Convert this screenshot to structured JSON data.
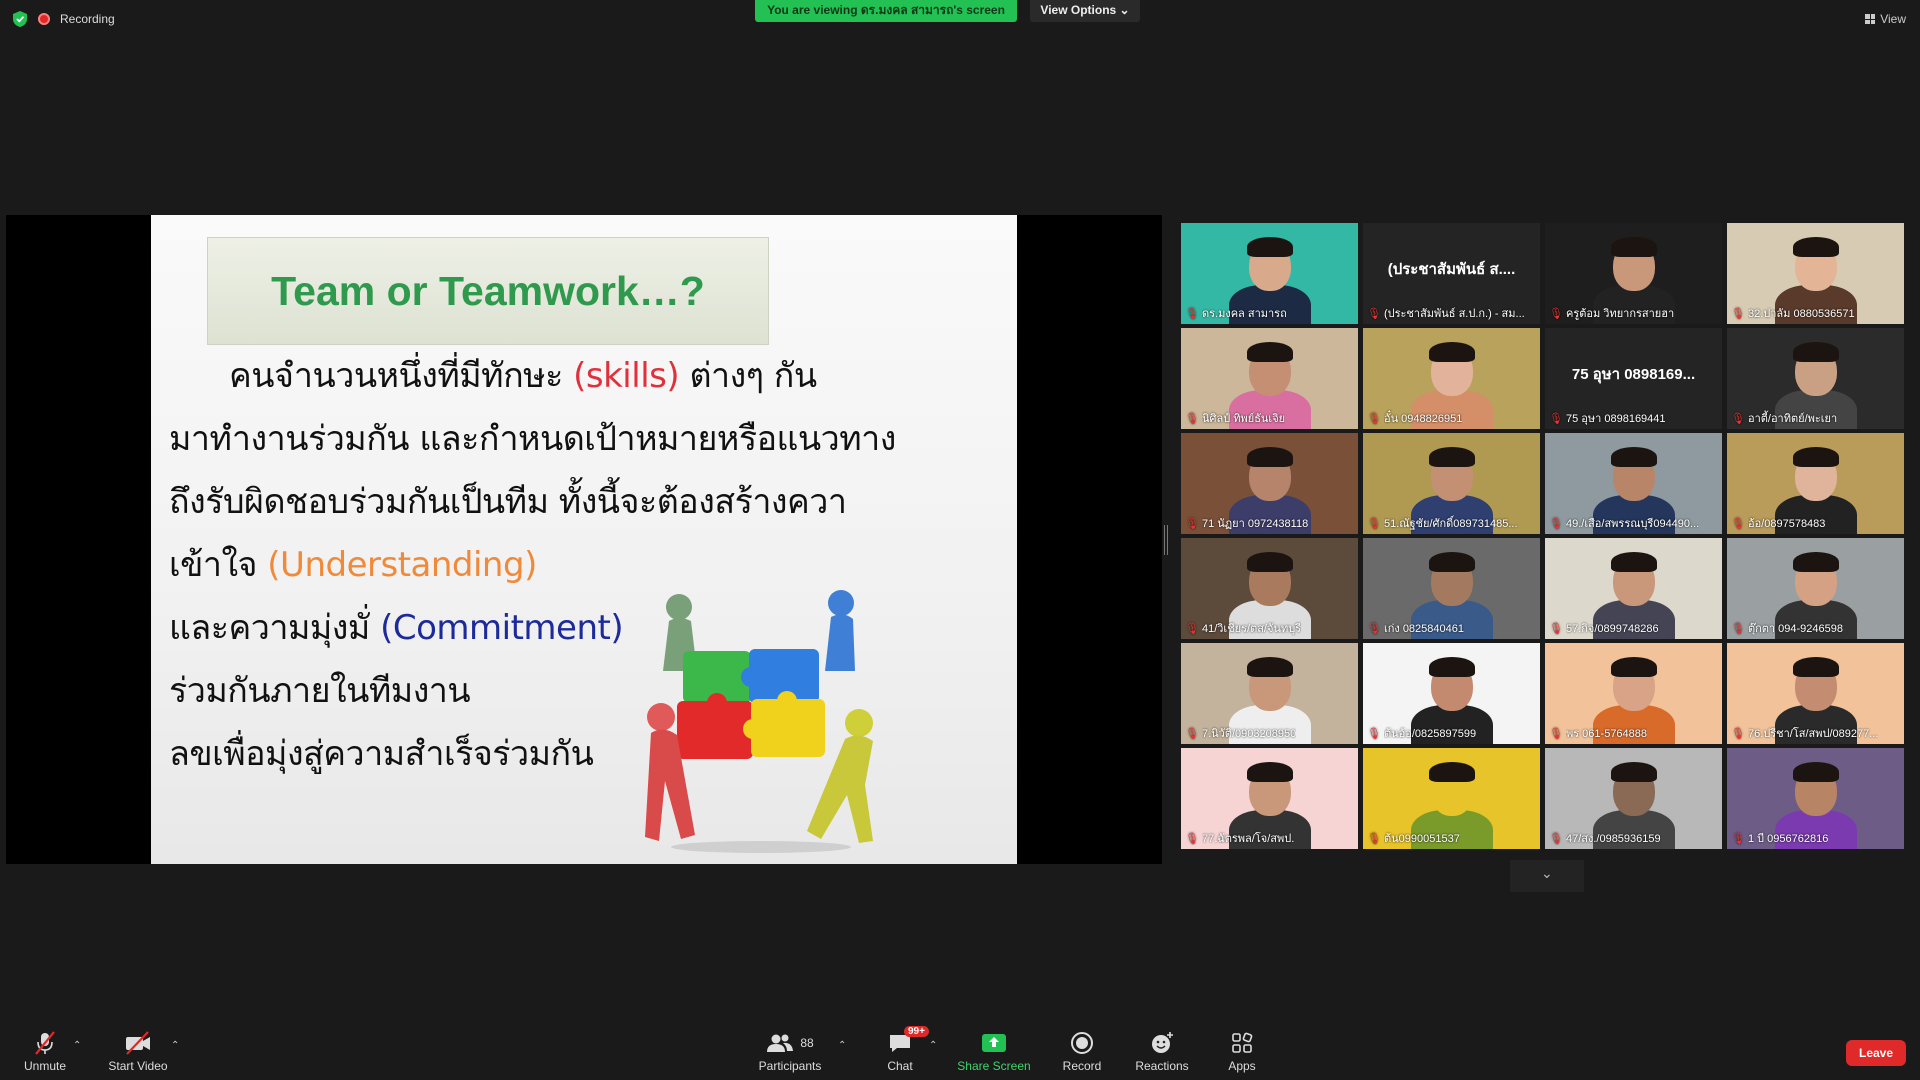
{
  "topbar": {
    "recording_label": "Recording",
    "viewing_banner": "You are viewing ดร.มงคล สามารถ's screen",
    "view_options": "View Options ⌄",
    "view_button": "View"
  },
  "slide": {
    "title": "Team or Teamwork…?",
    "lines": [
      {
        "pre": "คนจำนวนหนึ่งที่มีทักษะ ",
        "hl": "(skills)",
        "post": " ต่างๆ กัน"
      },
      {
        "pre": "มาทำงานร่วมกัน และกำหนดเป้าหมายหรือแนวทาง",
        "hl": "",
        "post": ""
      },
      {
        "pre": "ถึงรับผิดชอบร่วมกันเป็นทีม   ทั้งนี้จะต้องสร้างควา",
        "hl": "",
        "post": ""
      },
      {
        "pre": "เข้าใจ ",
        "hl": "(Understanding)",
        "post": ""
      },
      {
        "pre": "และความมุ่งมั่ ",
        "hl": "(Commitment)",
        "post": ""
      },
      {
        "pre": "ร่วมกันภายในทีมงาน",
        "hl": "",
        "post": ""
      },
      {
        "pre": "ลขเพื่อมุ่งสู่ความสำเร็จร่วมกัน",
        "hl": "",
        "post": ""
      }
    ]
  },
  "participants": [
    {
      "name": "ดร.มงคล สามารถ",
      "kind": "video",
      "bg": "#34b8a6",
      "skin": "#d8a98a",
      "shirt": "#1d2a44",
      "active": true
    },
    {
      "name": "(ประชาสัมพันธ์ ส.ป.ก.) - สม...",
      "kind": "text",
      "big": "(ประชาสัมพันธ์ ส...."
    },
    {
      "name": "ครูต้อม วิทยากรสายฮา",
      "kind": "video",
      "bg": "#1e1e1e",
      "skin": "#c9987a",
      "shirt": "#222"
    },
    {
      "name": "32.ปาลัม 0880536571",
      "kind": "video",
      "bg": "#d7cbb3",
      "skin": "#e3b596",
      "shirt": "#5a3a2a"
    },
    {
      "name": "นิศิลป์ ทิพย์ธันเจิย",
      "kind": "video",
      "bg": "#cdb79a",
      "skin": "#c48f72",
      "shirt": "#d86fa0"
    },
    {
      "name": "อั๋น 0948826951",
      "kind": "video",
      "bg": "#b9a25b",
      "skin": "#e2b39a",
      "shirt": "#d58f68"
    },
    {
      "name": "75 อุษา 0898169441",
      "kind": "text",
      "big": "75 อุษา 0898169..."
    },
    {
      "name": "อาตี้/อาทิตย์/พะเยา",
      "kind": "video",
      "bg": "#2b2b2b",
      "skin": "#c9a084",
      "shirt": "#444"
    },
    {
      "name": "71 นัฏยา 0972438118",
      "kind": "video",
      "bg": "#7a5039",
      "skin": "#b6846b",
      "shirt": "#3d3d6a"
    },
    {
      "name": "51.ณัฐชัย/ศักดิ์089731485...",
      "kind": "video",
      "bg": "#b09a52",
      "skin": "#c39074",
      "shirt": "#2f4070"
    },
    {
      "name": "49./เสือ/สพรรณบุรี094490...",
      "kind": "video",
      "bg": "#8e9aa0",
      "skin": "#b88568",
      "shirt": "#24365c"
    },
    {
      "name": "อ้อ/0897578483",
      "kind": "video",
      "bg": "#b99b5a",
      "skin": "#e0b49a",
      "shirt": "#222"
    },
    {
      "name": "41/วิเชียร/ตส/จันทบุรี",
      "kind": "video",
      "bg": "#5c4a3b",
      "skin": "#a97a5e",
      "shirt": "#ddd"
    },
    {
      "name": "เก่ง 0825840461",
      "kind": "video",
      "bg": "#6a6a6a",
      "skin": "#a37a60",
      "shirt": "#3a5a8a"
    },
    {
      "name": "57.กิจ/0899748286",
      "kind": "video",
      "bg": "#ddd8cc",
      "skin": "#c9977a",
      "shirt": "#445"
    },
    {
      "name": "ตุ๊กตา 094-9246598",
      "kind": "video",
      "bg": "#9aa0a2",
      "skin": "#d5a184",
      "shirt": "#333"
    },
    {
      "name": "7.นิวัติ/0903208950",
      "kind": "video",
      "bg": "#c3b39c",
      "skin": "#c9977a",
      "shirt": "#eee"
    },
    {
      "name": "ต้นอ้อ/0825897599",
      "kind": "video",
      "bg": "#f4f4f4",
      "skin": "#c48a70",
      "shirt": "#222"
    },
    {
      "name": "พร 061-5764888",
      "kind": "video",
      "bg": "#f2c39a",
      "skin": "#d8a386",
      "shirt": "#d86a2a"
    },
    {
      "name": "76.ปรีชา/โส/สพป/089277...",
      "kind": "video",
      "bg": "#f2c39a",
      "skin": "#c48c70",
      "shirt": "#2a2a2a"
    },
    {
      "name": "77.ฉัตรพล/โจ/สพป.",
      "kind": "video",
      "bg": "#f6d4d4",
      "skin": "#c9977a",
      "shirt": "#333"
    },
    {
      "name": "ต้น0990051537",
      "kind": "video",
      "bg": "#e6c42a",
      "skin": "#e6c42a",
      "shirt": "#7a9a2a"
    },
    {
      "name": "47/สง./0985936159",
      "kind": "video",
      "bg": "#b8b8b8",
      "skin": "#8a6a55",
      "shirt": "#444"
    },
    {
      "name": "1 บี 0956762816",
      "kind": "video",
      "bg": "#6d5d86",
      "skin": "#b78466",
      "shirt": "#7b3ab0"
    }
  ],
  "toolbar": {
    "unmute": "Unmute",
    "start_video": "Start Video",
    "participants": "Participants",
    "participants_count": "88",
    "chat": "Chat",
    "chat_badge": "99+",
    "share_screen": "Share Screen",
    "record": "Record",
    "reactions": "Reactions",
    "apps": "Apps",
    "leave": "Leave"
  },
  "colors": {
    "accent_green": "#23c053",
    "leave_red": "#e02a2a",
    "active_speaker": "#2ecc40"
  }
}
